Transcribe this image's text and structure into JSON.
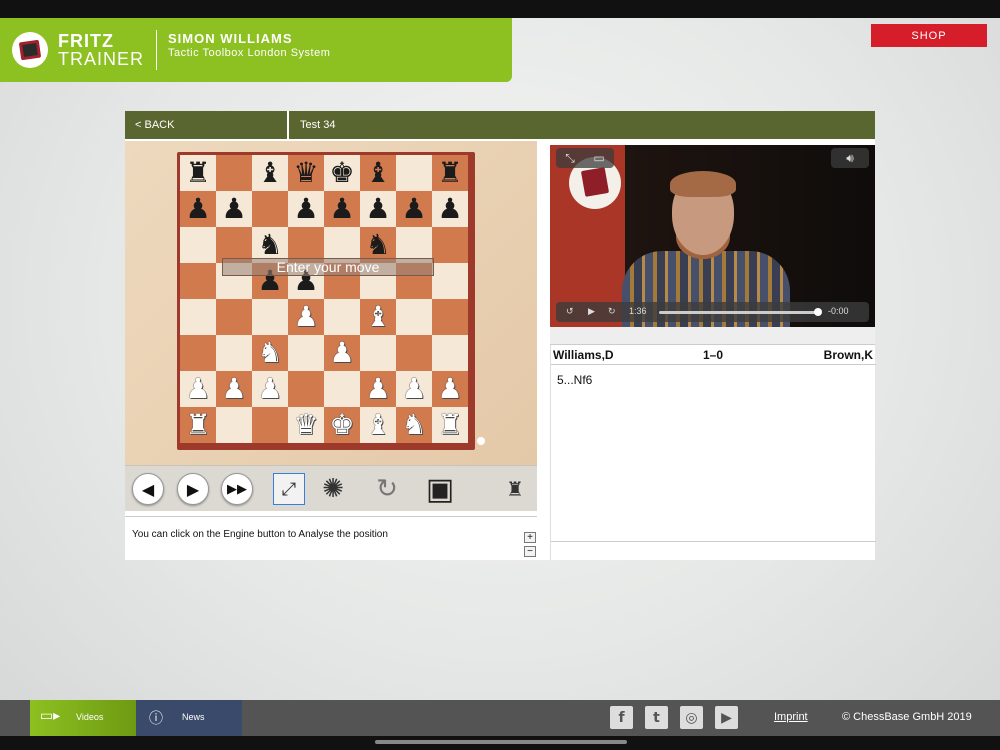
{
  "header": {
    "brand_line1": "FRITZ",
    "brand_line2": "TRAINER",
    "author": "SIMON WILLIAMS",
    "course": "Tactic Toolbox London System",
    "shop_label": "SHOP"
  },
  "panel": {
    "back_label": "< BACK",
    "test_title": "Test 34"
  },
  "board": {
    "prompt": "Enter your move",
    "ranks": [
      [
        "br",
        "",
        "bb",
        "bq",
        "bk",
        "bb",
        "",
        "br"
      ],
      [
        "bp",
        "bp",
        "",
        "bp",
        "bp",
        "bp",
        "bp",
        "bp"
      ],
      [
        "",
        "",
        "bn",
        "",
        "",
        "bn",
        "",
        ""
      ],
      [
        "",
        "",
        "bp",
        "bp",
        "",
        "",
        "",
        ""
      ],
      [
        "",
        "",
        "",
        "wp",
        "",
        "wb",
        "",
        ""
      ],
      [
        "",
        "",
        "wn",
        "",
        "wp",
        "",
        "",
        ""
      ],
      [
        "wp",
        "wp",
        "wp",
        "",
        "",
        "wp",
        "wp",
        "wp"
      ],
      [
        "wr",
        "",
        "",
        "wq",
        "wk",
        "wb",
        "wn",
        "wr"
      ]
    ]
  },
  "toolbar": {
    "buttons": [
      "back-arrow",
      "forward-arrow",
      "fast-forward",
      "fullscreen",
      "engine",
      "flip-board",
      "save",
      "board-setup"
    ]
  },
  "comment": {
    "text": "You can click on the Engine button to Analyse the position"
  },
  "video": {
    "time_elapsed": "1:36",
    "time_remaining": "-0:00",
    "progress": 0.98
  },
  "game": {
    "white": "Williams,D",
    "result": "1–0",
    "black": "Brown,K",
    "moves": "5...Nf6"
  },
  "footer": {
    "tab_videos": "Videos",
    "tab_news": "News",
    "imprint": "Imprint",
    "copyright": "© ChessBase GmbH 2019",
    "social": [
      "facebook-icon",
      "twitter-icon",
      "instagram-icon",
      "youtube-icon"
    ]
  },
  "colors": {
    "brand_green": "#8dc021",
    "nav_olive": "#596630",
    "shop_red": "#d61d2a",
    "board_light": "#f5e8d6",
    "board_dark": "#d07a4e"
  }
}
